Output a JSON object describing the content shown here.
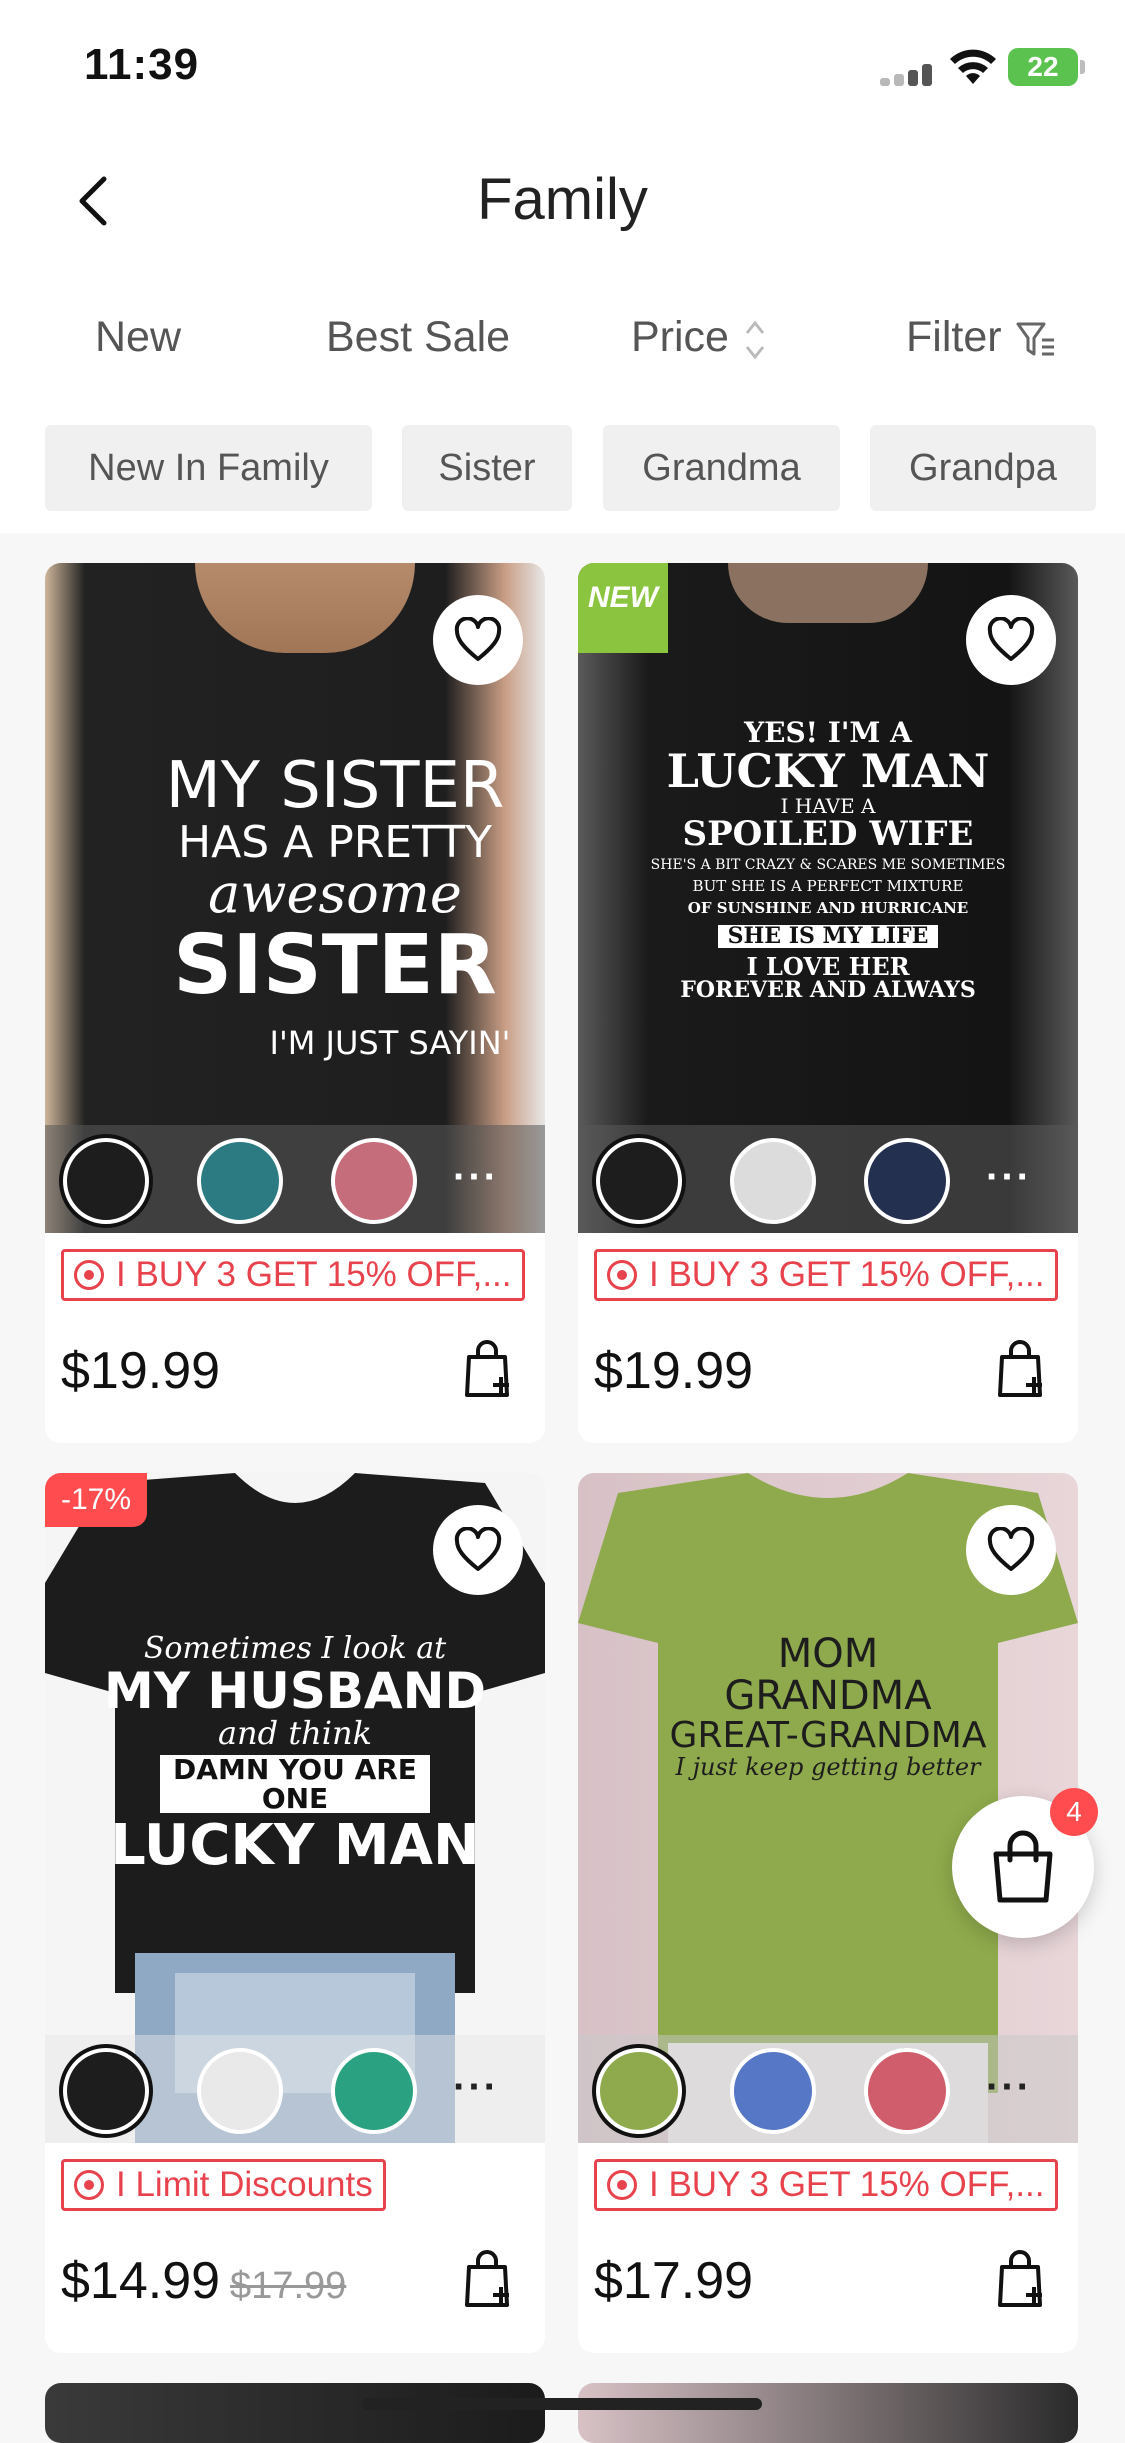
{
  "status": {
    "time": "11:39",
    "battery": "22"
  },
  "nav": {
    "title": "Family"
  },
  "sort": {
    "new": "New",
    "best_sale": "Best Sale",
    "price": "Price",
    "filter": "Filter"
  },
  "chips": [
    "New In Family",
    "Sister",
    "Grandma",
    "Grandpa"
  ],
  "products": [
    {
      "promo": "I BUY 3 GET 15% OFF,...",
      "price": "$19.99",
      "shirt_lines": [
        "MY SISTER",
        "HAS A PRETTY",
        "awesome",
        "SISTER",
        "I'M JUST SAYIN'"
      ]
    },
    {
      "badge": "NEW",
      "promo": "I BUY 3 GET 15% OFF,...",
      "price": "$19.99",
      "shirt_lines": [
        "YES! I'M A",
        "LUCKY MAN",
        "I HAVE A",
        "SPOILED WIFE",
        "SHE'S A BIT CRAZY & SCARES ME SOMETIMES",
        "BUT SHE IS A PERFECT MIXTURE",
        "OF SUNSHINE AND HURRICANE",
        "SHE IS MY LIFE",
        "I LOVE HER",
        "FOREVER AND ALWAYS"
      ]
    },
    {
      "badge": "-17%",
      "promo": "I Limit Discounts",
      "price": "$14.99",
      "old_price": "$17.99",
      "shirt_lines": [
        "Sometimes I look at",
        "MY HUSBAND",
        "and think",
        "DAMN YOU ARE ONE",
        "LUCKY MAN"
      ]
    },
    {
      "promo": "I BUY 3 GET 15% OFF,...",
      "price": "$17.99",
      "shirt_lines": [
        "MOM",
        "GRANDMA",
        "GREAT-GRANDMA",
        "I just keep getting better"
      ]
    }
  ],
  "cart": {
    "count": "4"
  },
  "colors": {
    "accent_red": "#e8424d",
    "badge_green": "#8bc53f",
    "discount_red": "#ff4d4f"
  }
}
